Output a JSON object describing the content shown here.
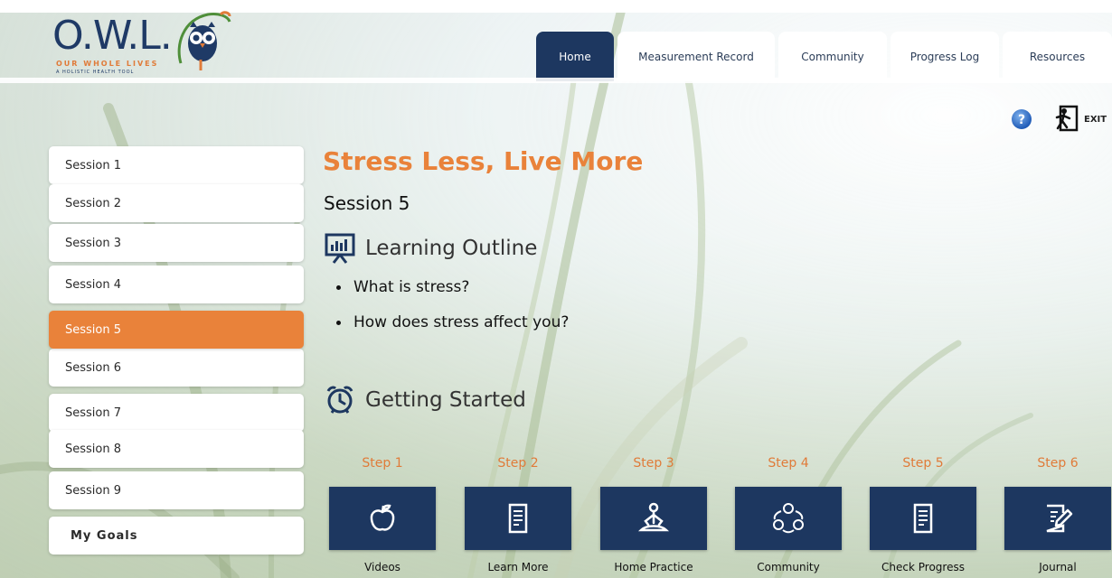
{
  "logo": {
    "wordmark": "O.W.L.",
    "tagline": "OUR WHOLE LIVES",
    "subtitle": "A HOLISTIC HEALTH TOOL"
  },
  "tabs": [
    {
      "label": "Home",
      "active": true
    },
    {
      "label": "Measurement Record",
      "active": false
    },
    {
      "label": "Community",
      "active": false
    },
    {
      "label": "Progress Log",
      "active": false
    },
    {
      "label": "Resources",
      "active": false
    }
  ],
  "header": {
    "help_icon": "question-circle-icon",
    "exit_label": "EXIT"
  },
  "sidebar": {
    "items": [
      {
        "label": "Session 1",
        "active": false
      },
      {
        "label": "Session 2",
        "active": false
      },
      {
        "label": "Session 3",
        "active": false
      },
      {
        "label": "Session 4",
        "active": false
      },
      {
        "label": "Session 5",
        "active": true
      },
      {
        "label": "Session 6",
        "active": false
      },
      {
        "label": "Session 7",
        "active": false
      },
      {
        "label": "Session 8",
        "active": false
      },
      {
        "label": "Session 9",
        "active": false
      },
      {
        "label": "My Goals",
        "active": false
      }
    ]
  },
  "main": {
    "title": "Stress Less, Live More",
    "session": "Session 5",
    "learning_outline": {
      "heading": "Learning Outline",
      "icon": "presentation-chart-icon",
      "items": [
        "What is stress?",
        "How does stress affect you?"
      ]
    },
    "getting_started": {
      "heading": "Getting Started",
      "icon": "alarm-clock-icon"
    },
    "steps": [
      {
        "step": "Step 1",
        "caption": "Videos",
        "icon": "apple-icon"
      },
      {
        "step": "Step 2",
        "caption": "Learn More",
        "icon": "document-icon"
      },
      {
        "step": "Step 3",
        "caption": "Home Practice",
        "icon": "meditation-icon"
      },
      {
        "step": "Step 4",
        "caption": "Community",
        "icon": "community-icon"
      },
      {
        "step": "Step 5",
        "caption": "Check Progress",
        "icon": "document-icon"
      },
      {
        "step": "Step 6",
        "caption": "Journal",
        "icon": "journal-edit-icon"
      }
    ]
  },
  "colors": {
    "accent": "#e9823a",
    "navy": "#1d3760"
  }
}
